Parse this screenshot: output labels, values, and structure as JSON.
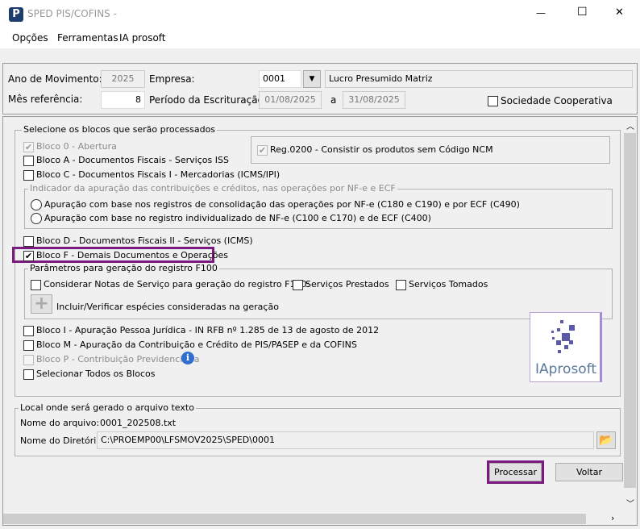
{
  "window": {
    "title": "SPED PIS/COFINS -",
    "minimize": "—",
    "maximize": "☐",
    "close": "✕"
  },
  "menu": [
    "Opções",
    "Ferramentas",
    "IA prosoft"
  ],
  "header": {
    "ano_label": "Ano de Movimento:",
    "ano_value": "2025",
    "empresa_label": "Empresa:",
    "empresa_code": "0001",
    "empresa_name": "Lucro Presumido Matriz",
    "mes_label": "Mês referência:",
    "mes_value": "8",
    "periodo_label": "Período da Escrituração:",
    "periodo_inicio": "01/08/2025",
    "periodo_sep": "a",
    "periodo_fim": "31/08/2025",
    "cooperativa_label": "Sociedade Cooperativa"
  },
  "blocos": {
    "legend": "Selecione os blocos que serão processados",
    "bloco0": "Bloco 0 - Abertura",
    "reg0200": "Reg.0200 - Consistir os produtos sem Código NCM",
    "blocoA": "Bloco A - Documentos Fiscais - Serviços  ISS",
    "blocoC": "Bloco C - Documentos Fiscais  I - Mercadorias  (ICMS/IPI)",
    "indicador_legend": "Indicador da apuração das contribuições e créditos, nas operações por NF-e e ECF",
    "radio1": "Apuração com base nos registros de consolidação das operações por  NF-e (C180 e C190) e por  ECF (C490)",
    "radio2": "Apuração com base no registro individualizado de NF-e (C100 e C170) e de ECF (C400)",
    "blocoD": "Bloco D - Documentos Fiscais II - Serviços  (ICMS)",
    "blocoF": "Bloco F - Demais Documentos e Operações",
    "f100_legend": "Parâmetros para geração do registro F100",
    "f100_check": "Considerar Notas de Serviço para geração do registro F100:",
    "prestados": "Serviços Prestados",
    "tomados": "Serviços Tomados",
    "incluir": "Incluir/Verificar espécies consideradas na geração",
    "blocoI": "Bloco I - Apuração Pessoa Jurídica - IN RFB nº 1.285 de 13 de agosto de 2012",
    "blocoM": "Bloco M - Apuração da Contribuição e Crédito de PIS/PASEP e da COFINS",
    "blocoP": "Bloco P - Contribuição Previdenciária",
    "todos": "Selecionar Todos os Blocos"
  },
  "logo": "IAprosoft",
  "local": {
    "legend": "Local onde será gerado o arquivo texto",
    "arquivo_label": "Nome do arquivo:",
    "arquivo_value": "0001_202508.txt",
    "diretorio_label": "Nome do Diretório:",
    "diretorio_value": "C:\\PROEMP00\\LFSMOV2025\\SPED\\0001"
  },
  "buttons": {
    "processar": "Processar",
    "voltar": "Voltar"
  },
  "colors": {
    "highlight": "#7b1a7f",
    "logo": "#5a5aa8"
  }
}
